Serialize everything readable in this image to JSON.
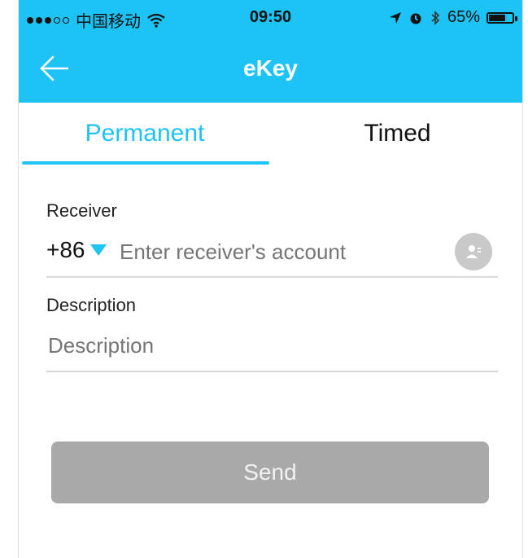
{
  "status_bar": {
    "carrier": "中国移动",
    "time": "09:50",
    "battery_percent": "65%"
  },
  "nav": {
    "title": "eKey"
  },
  "tabs": [
    {
      "label": "Permanent",
      "active": true
    },
    {
      "label": "Timed",
      "active": false
    }
  ],
  "form": {
    "receiver_label": "Receiver",
    "country_code": "+86",
    "receiver_placeholder": "Enter receiver's account",
    "description_label": "Description",
    "description_placeholder": "Description"
  },
  "actions": {
    "send_label": "Send"
  },
  "colors": {
    "accent": "#1ec3f5",
    "button_disabled": "#a9a9a9",
    "placeholder": "#bbbbbb"
  },
  "icons": {
    "back": "arrow-left-icon",
    "contact": "contact-person-icon",
    "dropdown": "triangle-down-icon",
    "wifi": "wifi-icon",
    "location": "location-arrow-icon",
    "alarm": "alarm-icon",
    "bluetooth": "bluetooth-icon",
    "battery": "battery-icon"
  }
}
